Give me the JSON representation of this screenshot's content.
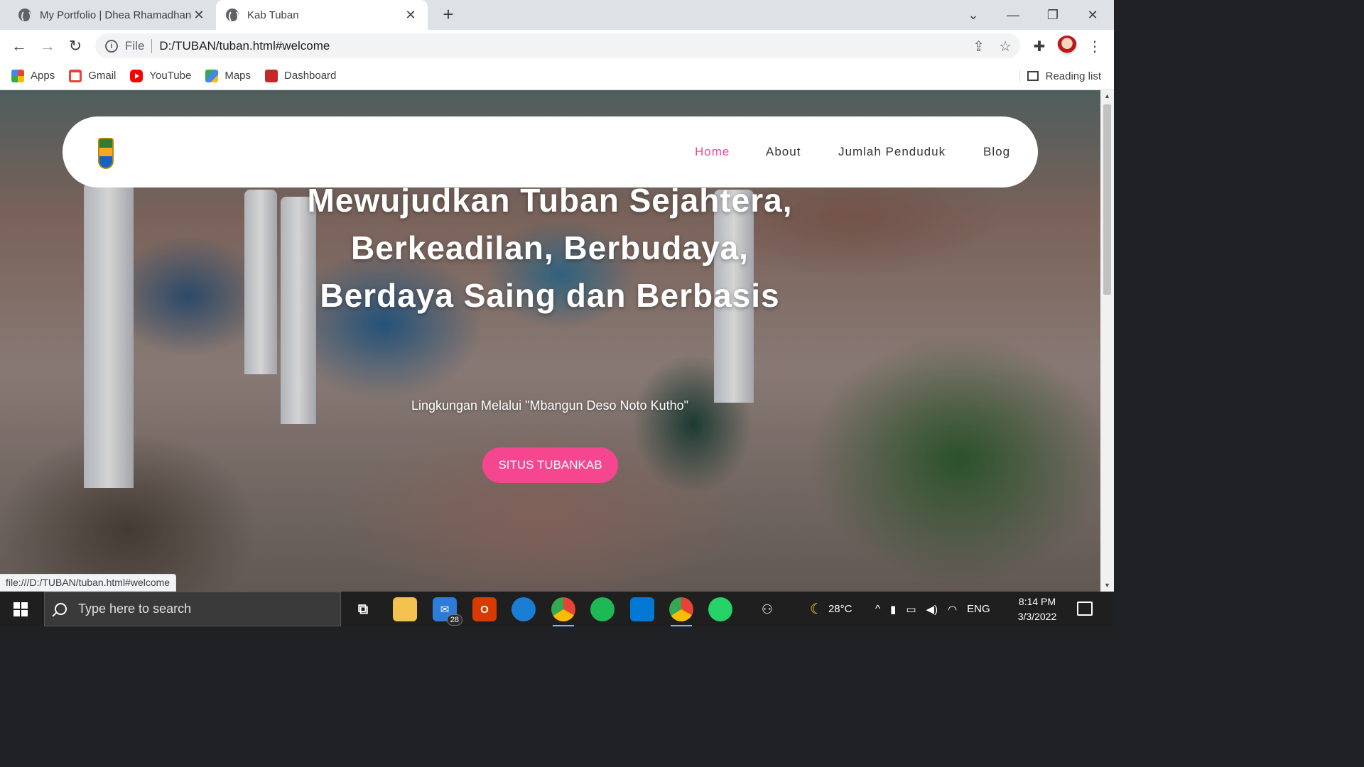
{
  "browser": {
    "tabs": [
      {
        "title": "My Portfolio | Dhea Rhamadhani",
        "active": false
      },
      {
        "title": "Kab Tuban",
        "active": true
      }
    ],
    "new_tab": "+",
    "address": {
      "scheme": "File",
      "url": "D:/TUBAN/tuban.html#welcome"
    },
    "bookmarks": [
      {
        "label": "Apps",
        "icon": "apps-grid-icon"
      },
      {
        "label": "Gmail",
        "icon": "gmail-icon"
      },
      {
        "label": "YouTube",
        "icon": "youtube-icon"
      },
      {
        "label": "Maps",
        "icon": "maps-icon"
      },
      {
        "label": "Dashboard",
        "icon": "dashboard-icon"
      }
    ],
    "reading_list": "Reading list",
    "status_url": "file:///D:/TUBAN/tuban.html#welcome"
  },
  "page": {
    "nav": {
      "links": [
        "Home",
        "About",
        "Jumlah Penduduk",
        "Blog"
      ],
      "active": "Home"
    },
    "hero": {
      "headline_plain": "Mewujudkan Tuban Sejahtera, ",
      "headline_bold": "Berkeadilan, Berbudaya, Berdaya Saing dan Berbasis",
      "subline": "Lingkungan Melalui \"Mbangun Deso Noto Kutho\"",
      "cta": "SITUS TUBANKAB"
    },
    "accent_color": "#f5468f"
  },
  "taskbar": {
    "search_placeholder": "Type here to search",
    "mail_badge": "28",
    "weather": "28°C",
    "language": "ENG",
    "time": "8:14 PM",
    "date": "3/3/2022"
  }
}
